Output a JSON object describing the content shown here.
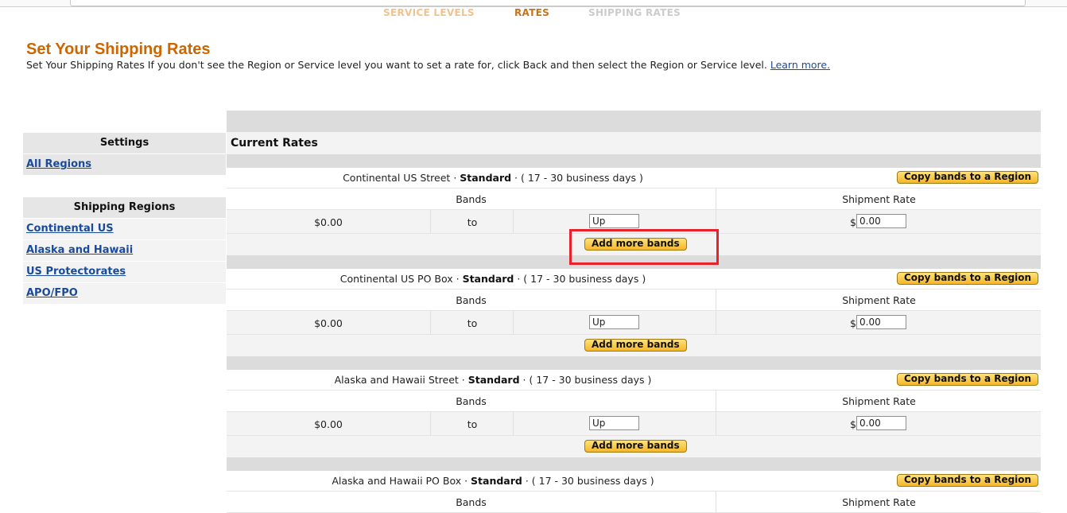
{
  "steps": [
    "SERVICE LEVELS",
    "RATES",
    "SHIPPING RATES"
  ],
  "header": {
    "title": "Set Your Shipping Rates",
    "subtitle": "Set Your Shipping Rates If you don't see the Region or Service level you want to set a rate for, click Back and then select the Region or Service level.",
    "learn_more": "Learn more."
  },
  "sidebar": {
    "settings_heading": "Settings",
    "settings_items": [
      "All Regions"
    ],
    "regions_heading": "Shipping Regions",
    "regions": [
      "Continental US",
      "Alaska and Hawaii",
      "US Protectorates",
      "APO/FPO"
    ]
  },
  "main": {
    "current_rates": "Current Rates",
    "copy_label": "Copy bands to a Region",
    "bands_label": "Bands",
    "rate_label": "Shipment Rate",
    "to_label": "to",
    "add_label": "Add more bands",
    "currency": "$",
    "sections": [
      {
        "region": "Continental US Street",
        "level": "Standard",
        "days": "( 17 - 30 business days )",
        "from": "$0.00",
        "upto": "Up",
        "rate": "0.00"
      },
      {
        "region": "Continental US PO Box",
        "level": "Standard",
        "days": "( 17 - 30 business days )",
        "from": "$0.00",
        "upto": "Up",
        "rate": "0.00"
      },
      {
        "region": "Alaska and Hawaii Street",
        "level": "Standard",
        "days": "( 17 - 30 business days )",
        "from": "$0.00",
        "upto": "Up",
        "rate": "0.00"
      },
      {
        "region": "Alaska and Hawaii PO Box",
        "level": "Standard",
        "days": "( 17 - 30 business days )",
        "from": "",
        "upto": "",
        "rate": ""
      }
    ]
  }
}
